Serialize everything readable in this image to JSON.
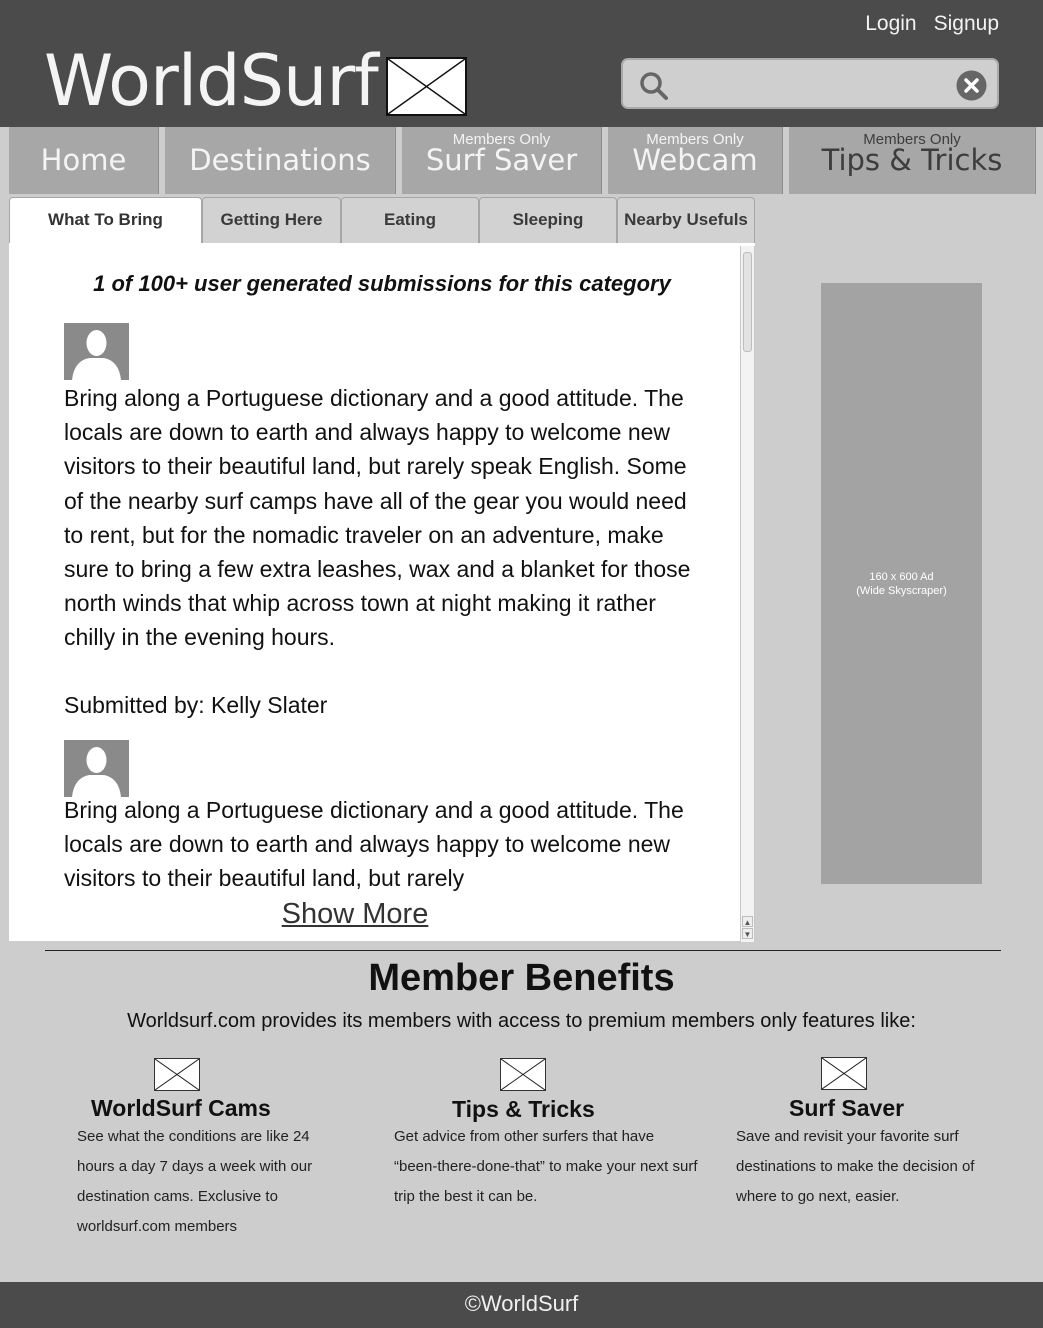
{
  "header": {
    "login_label": "Login",
    "signup_label": "Signup",
    "logo_text": "WorldSurf",
    "search": {
      "value": "",
      "placeholder": ""
    }
  },
  "nav": {
    "items": [
      {
        "label": "Home",
        "sub": ""
      },
      {
        "label": "Destinations",
        "sub": ""
      },
      {
        "label": "Surf Saver",
        "sub": "Members Only"
      },
      {
        "label": "Webcam",
        "sub": "Members Only"
      },
      {
        "label": "Tips & Tricks",
        "sub": "Members Only"
      }
    ]
  },
  "tabs": {
    "items": [
      "What To Bring",
      "Getting Here",
      "Eating",
      "Sleeping",
      "Nearby Usefuls"
    ],
    "active": "What To Bring"
  },
  "content": {
    "title": "1 of 100+ user generated submissions for this category",
    "posts": [
      {
        "text": "Bring along a Portuguese dictionary and a good attitude. The locals are down to earth and always happy to welcome new visitors to their beautiful land, but rarely speak English. Some of the nearby surf camps have all of the gear you would need to rent, but for the nomadic traveler on an adventure, make sure to bring a few extra leashes, wax and a blanket for those north winds that whip across town at night making it rather chilly in the evening hours.",
        "submitted_by": "Submitted by: Kelly Slater"
      },
      {
        "text": "Bring along a Portuguese dictionary and a good attitude. The locals are down to earth and always happy to welcome new visitors to their beautiful land, but rarely"
      }
    ],
    "show_more_label": "Show More"
  },
  "ad": {
    "line1": "160 x 600 Ad",
    "line2": "(Wide Skyscraper)"
  },
  "benefits": {
    "title": "Member Benefits",
    "intro": "Worldsurf.com provides its members with access to premium members only features like:",
    "features": [
      {
        "title": "WorldSurf Cams",
        "desc": "See what the conditions are like 24 hours a day 7 days a week with our destination cams. Exclusive to worldsurf.com members"
      },
      {
        "title": "Tips & Tricks",
        "desc": "Get advice from other surfers that have “been-there-done-that” to make your next surf trip the best it can be."
      },
      {
        "title": "Surf Saver",
        "desc": "Save and revisit your favorite surf destinations to make the decision of where to go next, easier."
      }
    ]
  },
  "footer": {
    "text": "©WorldSurf"
  },
  "colors": {
    "header_bg": "#4b4b4b",
    "nav_bg": "#a7a7a7",
    "page_bg": "#cdcdcd",
    "ad_bg": "#a3a3a3"
  },
  "icons": {
    "search": "search-icon",
    "clear": "clear-icon",
    "logo_placeholder": "image-placeholder-icon",
    "avatar": "user-avatar-icon"
  }
}
